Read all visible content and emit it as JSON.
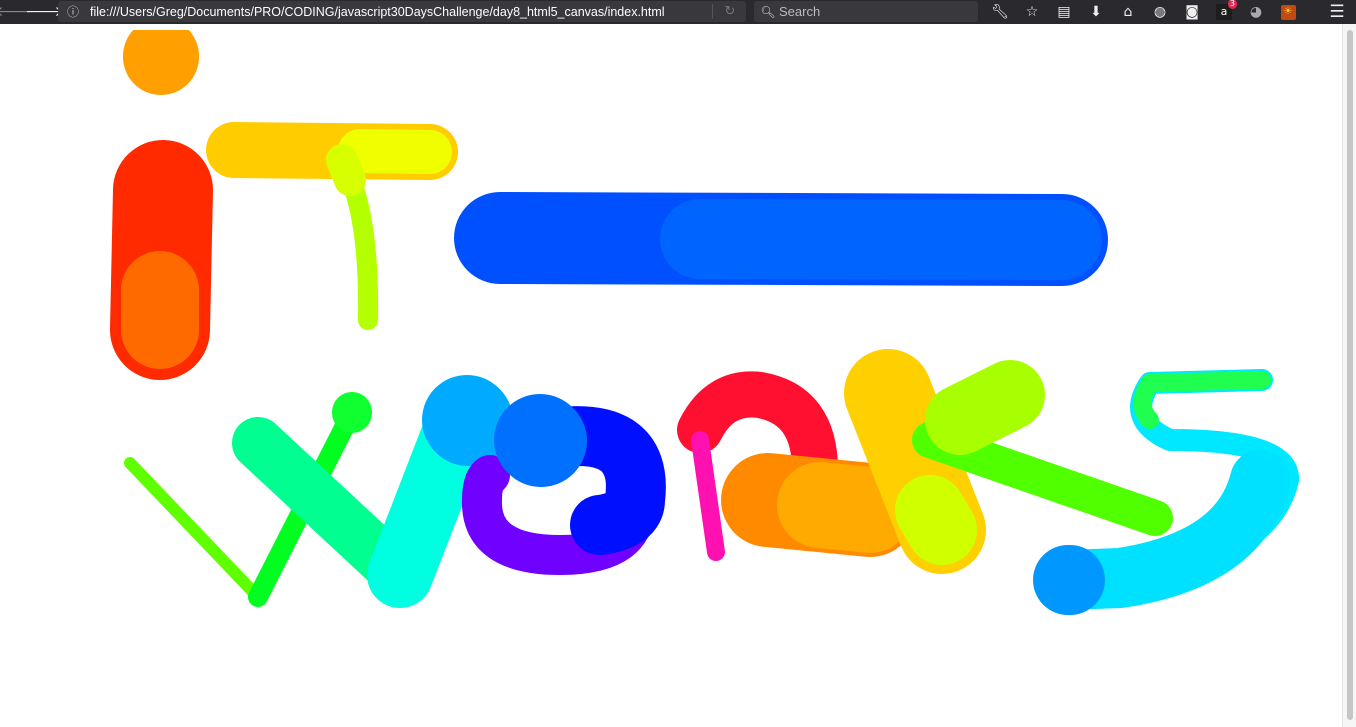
{
  "browser": {
    "url": "file:///Users/Greg/Documents/PRO/CODING/javascript30DaysChallenge/day8_html5_canvas/index.html",
    "search_placeholder": "Search",
    "addon_badge_count": "3",
    "icons": [
      "back-icon",
      "forward-icon",
      "info-icon",
      "reload-icon",
      "search-icon",
      "wrench-icon",
      "bookmark-star-icon",
      "reading-list-icon",
      "download-icon",
      "home-icon",
      "globe-icon",
      "pocket-icon",
      "amazon-addon-icon",
      "eye-addon-icon",
      "sun-addon-icon",
      "menu-icon"
    ]
  },
  "canvas": {
    "background": "#ffffff",
    "stroke_colors": [
      "#ffa000",
      "#ff2000",
      "#ff6000",
      "#ffc800",
      "#f0ff00",
      "#b4ff00",
      "#0040ff",
      "#0080ff",
      "#00ff00",
      "#00ff90",
      "#00ffe0",
      "#00a0ff",
      "#8000ff",
      "#0000ff",
      "#ff0040",
      "#ff00c0",
      "#ff8000",
      "#d0ff00",
      "#00c0ff"
    ]
  }
}
